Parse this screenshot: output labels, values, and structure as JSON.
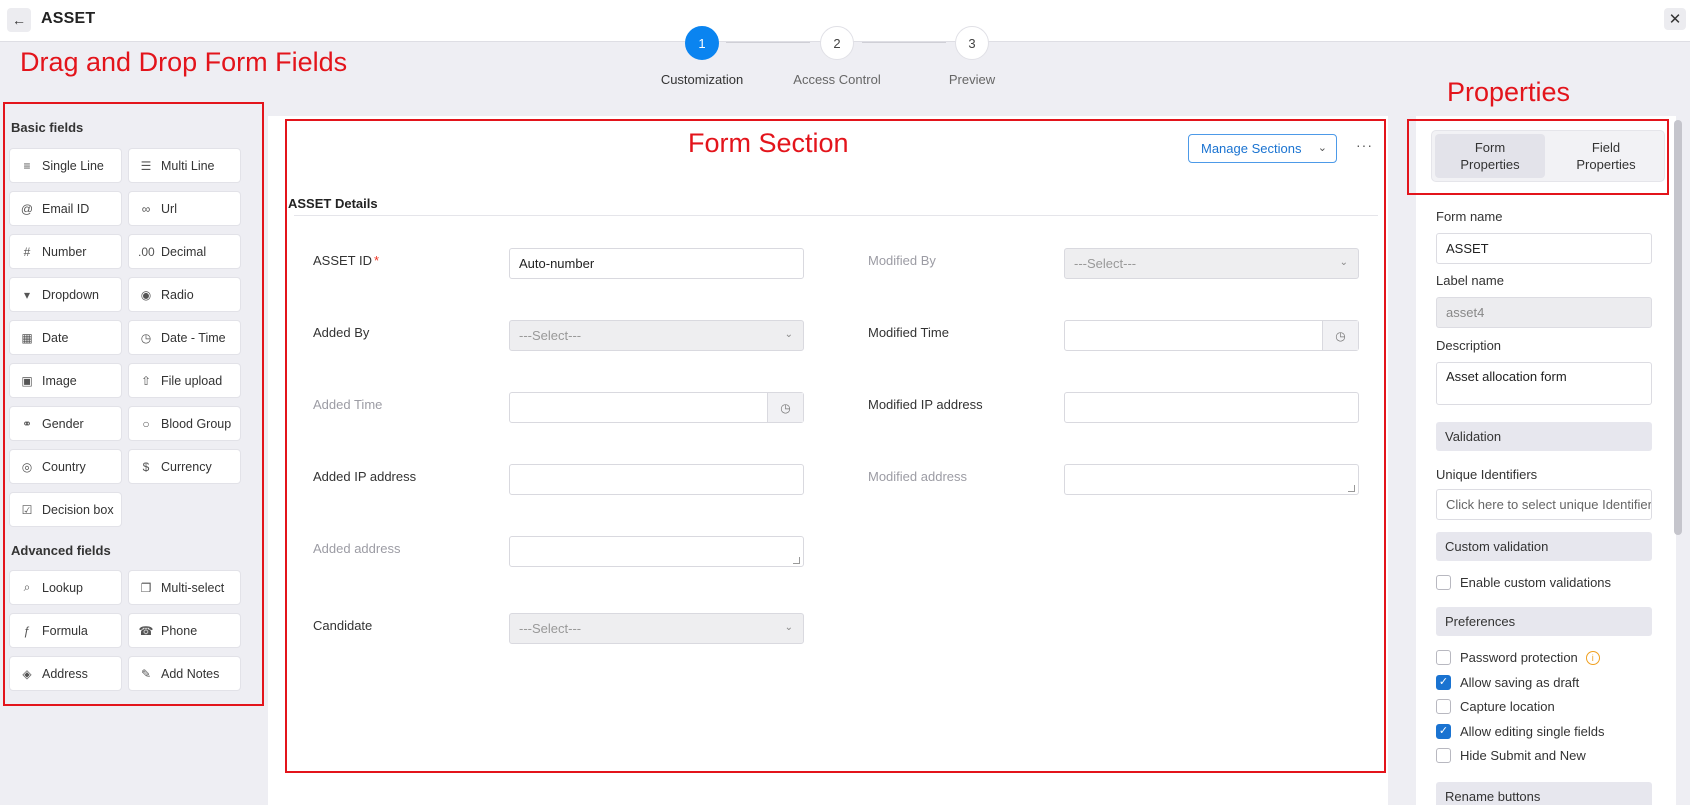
{
  "window": {
    "title": "ASSET"
  },
  "stepper": {
    "steps": [
      {
        "number": "1",
        "label": "Customization"
      },
      {
        "number": "2",
        "label": "Access Control"
      },
      {
        "number": "3",
        "label": "Preview"
      }
    ]
  },
  "annotations": {
    "left": "Drag and Drop Form Fields",
    "center": "Form Section",
    "right": "Properties",
    "color": "#e3141b"
  },
  "fields_panel": {
    "basic_title": "Basic fields",
    "basic": [
      {
        "label": "Single Line",
        "icon": "single-line-icon"
      },
      {
        "label": "Multi Line",
        "icon": "multi-line-icon"
      },
      {
        "label": "Email ID",
        "icon": "at-icon"
      },
      {
        "label": "Url",
        "icon": "link-icon"
      },
      {
        "label": "Number",
        "icon": "hash-icon"
      },
      {
        "label": "Decimal",
        "icon": "decimal-icon"
      },
      {
        "label": "Dropdown",
        "icon": "dropdown-icon"
      },
      {
        "label": "Radio",
        "icon": "radio-icon"
      },
      {
        "label": "Date",
        "icon": "calendar-icon"
      },
      {
        "label": "Date - Time",
        "icon": "calendar-clock-icon"
      },
      {
        "label": "Image",
        "icon": "image-icon"
      },
      {
        "label": "File upload",
        "icon": "file-upload-icon"
      },
      {
        "label": "Gender",
        "icon": "gender-icon"
      },
      {
        "label": "Blood Group",
        "icon": "drop-icon"
      },
      {
        "label": "Country",
        "icon": "globe-icon"
      },
      {
        "label": "Currency",
        "icon": "currency-icon"
      },
      {
        "label": "Decision box",
        "icon": "checkbox-icon"
      }
    ],
    "advanced_title": "Advanced fields",
    "advanced": [
      {
        "label": "Lookup",
        "icon": "lookup-icon"
      },
      {
        "label": "Multi-select",
        "icon": "multi-select-icon"
      },
      {
        "label": "Formula",
        "icon": "formula-icon"
      },
      {
        "label": "Phone",
        "icon": "phone-icon"
      },
      {
        "label": "Address",
        "icon": "location-pin-icon"
      },
      {
        "label": "Add Notes",
        "icon": "notes-icon"
      }
    ]
  },
  "form": {
    "manage_sections": "Manage Sections",
    "section_title": "ASSET Details",
    "left_fields": [
      {
        "label": "ASSET ID",
        "required": "*",
        "value": "Auto-number"
      },
      {
        "label": "Added By",
        "placeholder": "---Select---"
      },
      {
        "label": "Added Time",
        "value": ""
      },
      {
        "label": "Added IP address",
        "value": ""
      },
      {
        "label": "Added address",
        "value": ""
      },
      {
        "label": "Candidate",
        "placeholder": "---Select---"
      }
    ],
    "right_fields": [
      {
        "label": "Modified By",
        "placeholder": "---Select---"
      },
      {
        "label": "Modified Time",
        "value": ""
      },
      {
        "label": "Modified IP address",
        "value": ""
      },
      {
        "label": "Modified address",
        "value": ""
      }
    ]
  },
  "properties": {
    "tabs": [
      {
        "line1": "Form",
        "line2": "Properties",
        "active": true
      },
      {
        "line1": "Field",
        "line2": "Properties",
        "active": false
      }
    ],
    "form_name_label": "Form name",
    "form_name": "ASSET",
    "label_name_label": "Label name",
    "label_name": "asset4",
    "description_label": "Description",
    "description": "Asset allocation form",
    "validation_header": "Validation",
    "unique_label": "Unique Identifiers",
    "unique_placeholder": "Click here to select unique Identifiers",
    "custom_validation_header": "Custom validation",
    "enable_custom": "Enable custom validations",
    "preferences_header": "Preferences",
    "preferences": [
      {
        "label": "Password protection",
        "checked": false,
        "info": true
      },
      {
        "label": "Allow saving as draft",
        "checked": true
      },
      {
        "label": "Capture location",
        "checked": false
      },
      {
        "label": "Allow editing single fields",
        "checked": true
      },
      {
        "label": "Hide Submit and New",
        "checked": false
      }
    ],
    "rename_header": "Rename buttons"
  },
  "colors": {
    "accent": "#0a84f0",
    "link": "#1a73d1"
  }
}
